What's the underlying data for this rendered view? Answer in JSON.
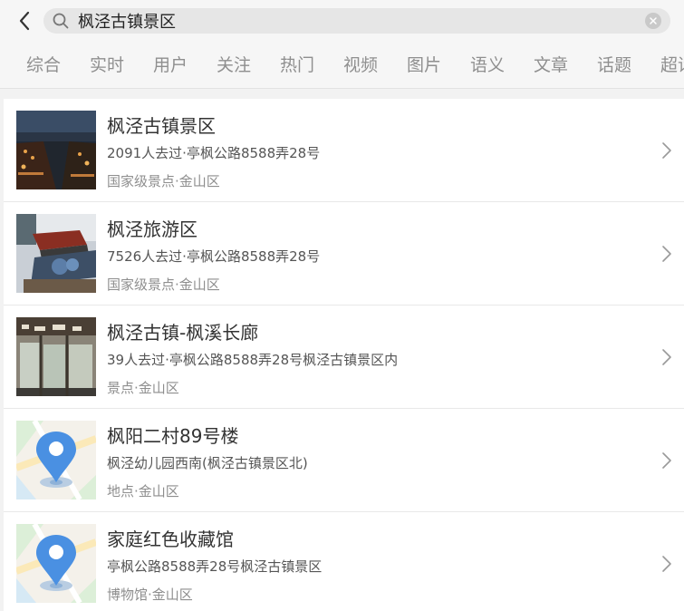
{
  "search": {
    "query": "枫泾古镇景区"
  },
  "tabs": [
    {
      "label": "综合"
    },
    {
      "label": "实时"
    },
    {
      "label": "用户"
    },
    {
      "label": "关注"
    },
    {
      "label": "热门"
    },
    {
      "label": "视频"
    },
    {
      "label": "图片"
    },
    {
      "label": "语义"
    },
    {
      "label": "文章"
    },
    {
      "label": "话题"
    },
    {
      "label": "超话"
    }
  ],
  "results": [
    {
      "title": "枫泾古镇景区",
      "address": "2091人去过·亭枫公路8588弄28号",
      "category": "国家级景点·金山区",
      "thumb": "night-canal-photo"
    },
    {
      "title": "枫泾旅游区",
      "address": "7526人去过·亭枫公路8588弄28号",
      "category": "国家级景点·金山区",
      "thumb": "boat-photo"
    },
    {
      "title": "枫泾古镇-枫溪长廊",
      "address": "39人去过·亭枫公路8588弄28号枫泾古镇景区内",
      "category": "景点·金山区",
      "thumb": "corridor-photo"
    },
    {
      "title": "枫阳二村89号楼",
      "address": "枫泾幼儿园西南(枫泾古镇景区北)",
      "category": "地点·金山区",
      "thumb": "map-pin-icon"
    },
    {
      "title": "家庭红色收藏馆",
      "address": "亭枫公路8588弄28号枫泾古镇景区",
      "category": "博物馆·金山区",
      "thumb": "map-pin-icon"
    }
  ],
  "colors": {
    "pin": "#4a90e2",
    "background": "#f2f2f2"
  }
}
